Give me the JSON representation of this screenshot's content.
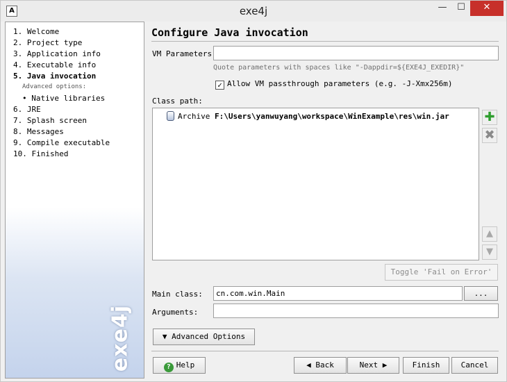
{
  "window": {
    "title": "exe4j"
  },
  "steps": [
    {
      "label": "1.  Welcome"
    },
    {
      "label": "2.  Project type"
    },
    {
      "label": "3.  Application info"
    },
    {
      "label": "4.  Executable info"
    },
    {
      "label": "5.  Java invocation",
      "active": true
    },
    {
      "label": "6.  JRE"
    },
    {
      "label": "7.  Splash screen"
    },
    {
      "label": "8.  Messages"
    },
    {
      "label": "9.  Compile executable"
    },
    {
      "label": "10.  Finished"
    }
  ],
  "advanced": {
    "label": "Advanced options:",
    "item": "• Native libraries"
  },
  "brand": "exe4j",
  "page": {
    "heading": "Configure Java invocation",
    "vm_params": {
      "label": "VM Parameters:",
      "value": ""
    },
    "hint": "Quote parameters with spaces like \"-Dappdir=${EXE4J_EXEDIR}\"",
    "passthrough": {
      "label": "Allow VM passthrough parameters (e.g. -J-Xmx256m)",
      "checked": true
    },
    "classpath": {
      "label": "Class path:",
      "entries": [
        {
          "type": "Archive",
          "path": "F:\\Users\\yanwuyang\\workspace\\WinExample\\res\\win.jar"
        }
      ]
    },
    "toggle_label": "Toggle 'Fail on Error'",
    "main_class": {
      "label": "Main class:",
      "value": "cn.com.win.Main",
      "browse": "..."
    },
    "arguments": {
      "label": "Arguments:",
      "value": ""
    },
    "advanced_options": "Advanced Options"
  },
  "footer": {
    "help": "Help",
    "back": "Back",
    "next": "Next",
    "finish": "Finish",
    "cancel": "Cancel"
  }
}
